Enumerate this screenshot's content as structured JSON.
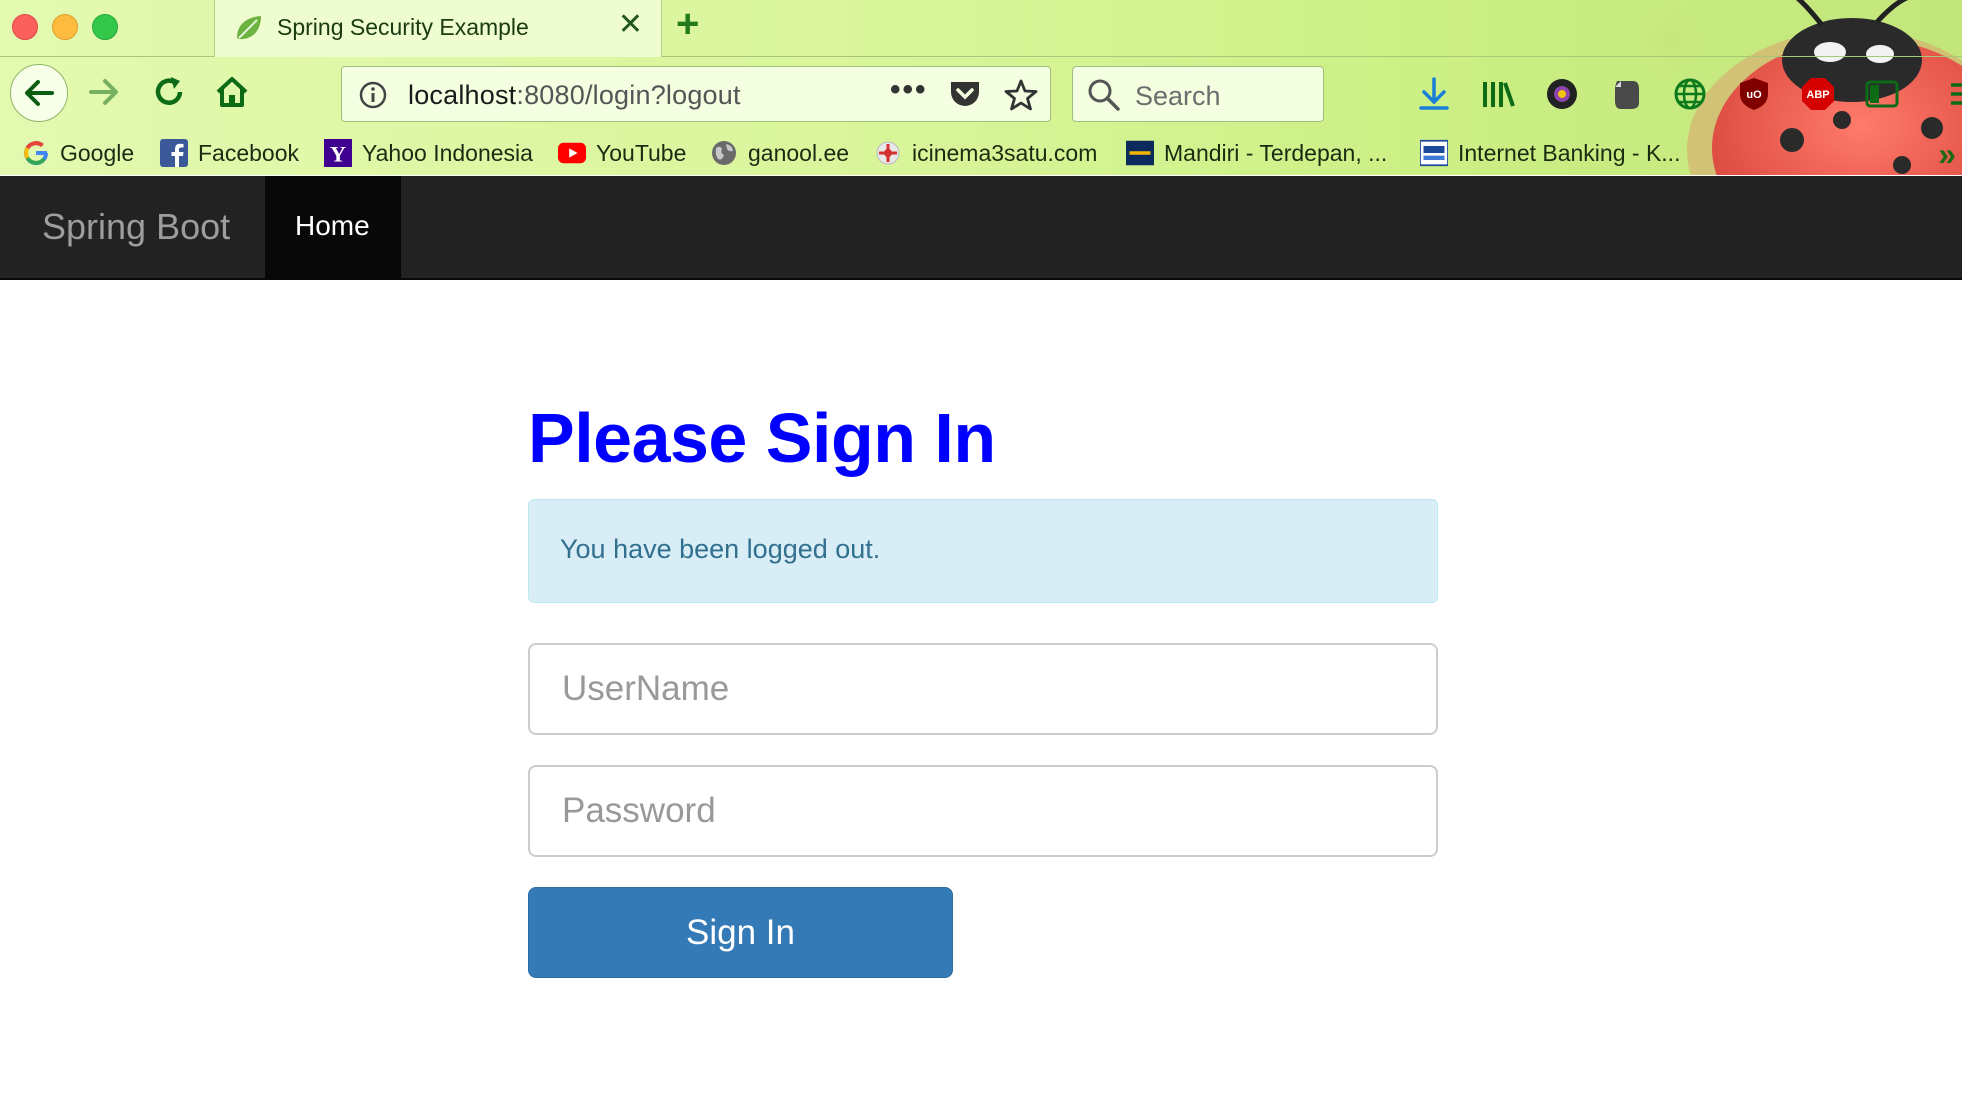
{
  "browser": {
    "tab": {
      "title": "Spring Security Example",
      "favicon": "spring-leaf-icon",
      "close_glyph": "✕"
    },
    "new_tab_glyph": "+",
    "url": {
      "host": "localhost",
      "rest": ":8080/login?logout"
    },
    "url_menu_glyph": "•••",
    "search_placeholder": "Search",
    "bookmarks": [
      {
        "label": "Google",
        "icon": "google-icon"
      },
      {
        "label": "Facebook",
        "icon": "facebook-icon"
      },
      {
        "label": "Yahoo Indonesia",
        "icon": "yahoo-icon"
      },
      {
        "label": "YouTube",
        "icon": "youtube-icon"
      },
      {
        "label": "ganool.ee",
        "icon": "globe-icon"
      },
      {
        "label": "icinema3satu.com",
        "icon": "icinema-icon"
      },
      {
        "label": "Mandiri - Terdepan, ...",
        "icon": "mandiri-icon"
      },
      {
        "label": "Internet Banking - K...",
        "icon": "klikbca-icon"
      }
    ],
    "bookmarks_overflow_glyph": "»",
    "toolbar_icons": [
      "download-icon",
      "library-icon",
      "colorpicker-icon",
      "evernote-icon",
      "globe-vpn-icon",
      "ublock-icon",
      "adblock-plus-icon",
      "sidebar-icon",
      "menu-icon"
    ],
    "abp_text": "ABP",
    "ublock_text": "uO"
  },
  "site": {
    "brand": "Spring Boot",
    "nav_home": "Home"
  },
  "login": {
    "title": "Please Sign In",
    "alert": "You have been logged out.",
    "username_placeholder": "UserName",
    "password_placeholder": "Password",
    "submit_label": "Sign In"
  },
  "colors": {
    "title": "#0000ff",
    "alert_bg": "#d9edf7",
    "alert_text": "#31708f",
    "button_bg": "#337ab7",
    "navbar_bg": "#222222"
  }
}
